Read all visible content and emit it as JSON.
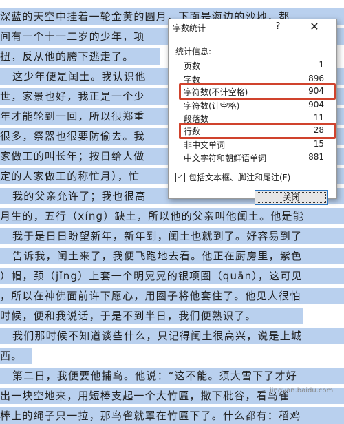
{
  "document": {
    "lines": [
      "深蓝的天空中挂着一轮金黄的圆月，下面是海边的沙地，都",
      "间有一个十一二岁的少年，项",
      "扭，反从他的胯下逃走了。",
      "这少年便是闰土。我认识他",
      "世，家景也好，我正是一个少",
      "年才能轮到一回，所以很郑重",
      "很多，祭器也很要防偷去。我",
      "家做工的叫长年；按日给人做",
      "定的人家做工的称忙月），忙",
      "我的父亲允许了；我也很高",
      "月生的，五行（xíng）缺土，所以他的父亲叫他闰土。他是能",
      "我于是日日盼望新年，新年到，闰土也就到了。好容易到了",
      "告诉我，闰土来了，我便飞跑地去看。他正在厨房里，紫色",
      "）帽，颈（jǐng）上套一个明晃晃的银项圈（quān），这可见",
      "，所以在神佛面前许下愿心，用圈子将他套住了。他见人很怕",
      "时候，便和我说话，于是不到半日，我们便熟识了。",
      "我们那时候不知道谈些什么，只记得闰土很高兴，说是上城",
      "西。",
      "第二日，我便要他捕鸟。他说：“这不能。须大雪下了才好",
      "出一块空地来，用短棒支起一个大竹匾，撒下秕谷，看鸟雀",
      "棒上的绳子只一拉，那鸟雀就罩在竹匾下了。什么都有：稻鸡"
    ]
  },
  "dialog": {
    "title": "字数统计",
    "help_label": "?",
    "close_label": "✕",
    "section_label": "统计信息:",
    "stats": [
      {
        "label": "页数",
        "value": "1"
      },
      {
        "label": "字数",
        "value": "896"
      },
      {
        "label": "字符数(不计空格)",
        "value": "904"
      },
      {
        "label": "字符数(计空格)",
        "value": "904"
      },
      {
        "label": "段落数",
        "value": "11"
      },
      {
        "label": "行数",
        "value": "28"
      },
      {
        "label": "非中文单词",
        "value": "15"
      },
      {
        "label": "中文字符和朝鲜语单词",
        "value": "881"
      }
    ],
    "checkbox_label": "包括文本框、脚注和尾注(F)",
    "checkbox_checked": "✓",
    "close_button_label": "关闭"
  },
  "colors": {
    "selection": "#b9d0ee",
    "highlight_box": "#d0432d"
  },
  "watermark": "jingyan.baidu.com"
}
